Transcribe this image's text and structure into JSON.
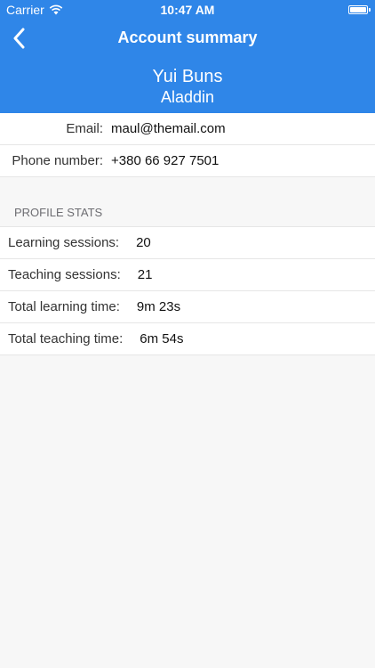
{
  "status_bar": {
    "carrier": "Carrier",
    "time": "10:47 AM"
  },
  "nav": {
    "title": "Account summary",
    "back_icon": "chevron-left-icon"
  },
  "profile": {
    "name": "Yui Buns",
    "subtitle": "Aladdin"
  },
  "info": {
    "email_label": "Email:",
    "email_value": "maul@themail.com",
    "phone_label": "Phone number:",
    "phone_value": "+380 66 927 7501"
  },
  "stats": {
    "header": "PROFILE STATS",
    "rows": [
      {
        "label": "Learning sessions:",
        "value": "20"
      },
      {
        "label": "Teaching sessions:",
        "value": "21"
      },
      {
        "label": "Total learning time:",
        "value": "9m 23s"
      },
      {
        "label": "Total teaching time:",
        "value": "6m 54s"
      }
    ]
  },
  "colors": {
    "header_bg": "#2f86e8",
    "page_bg": "#f7f7f7"
  }
}
